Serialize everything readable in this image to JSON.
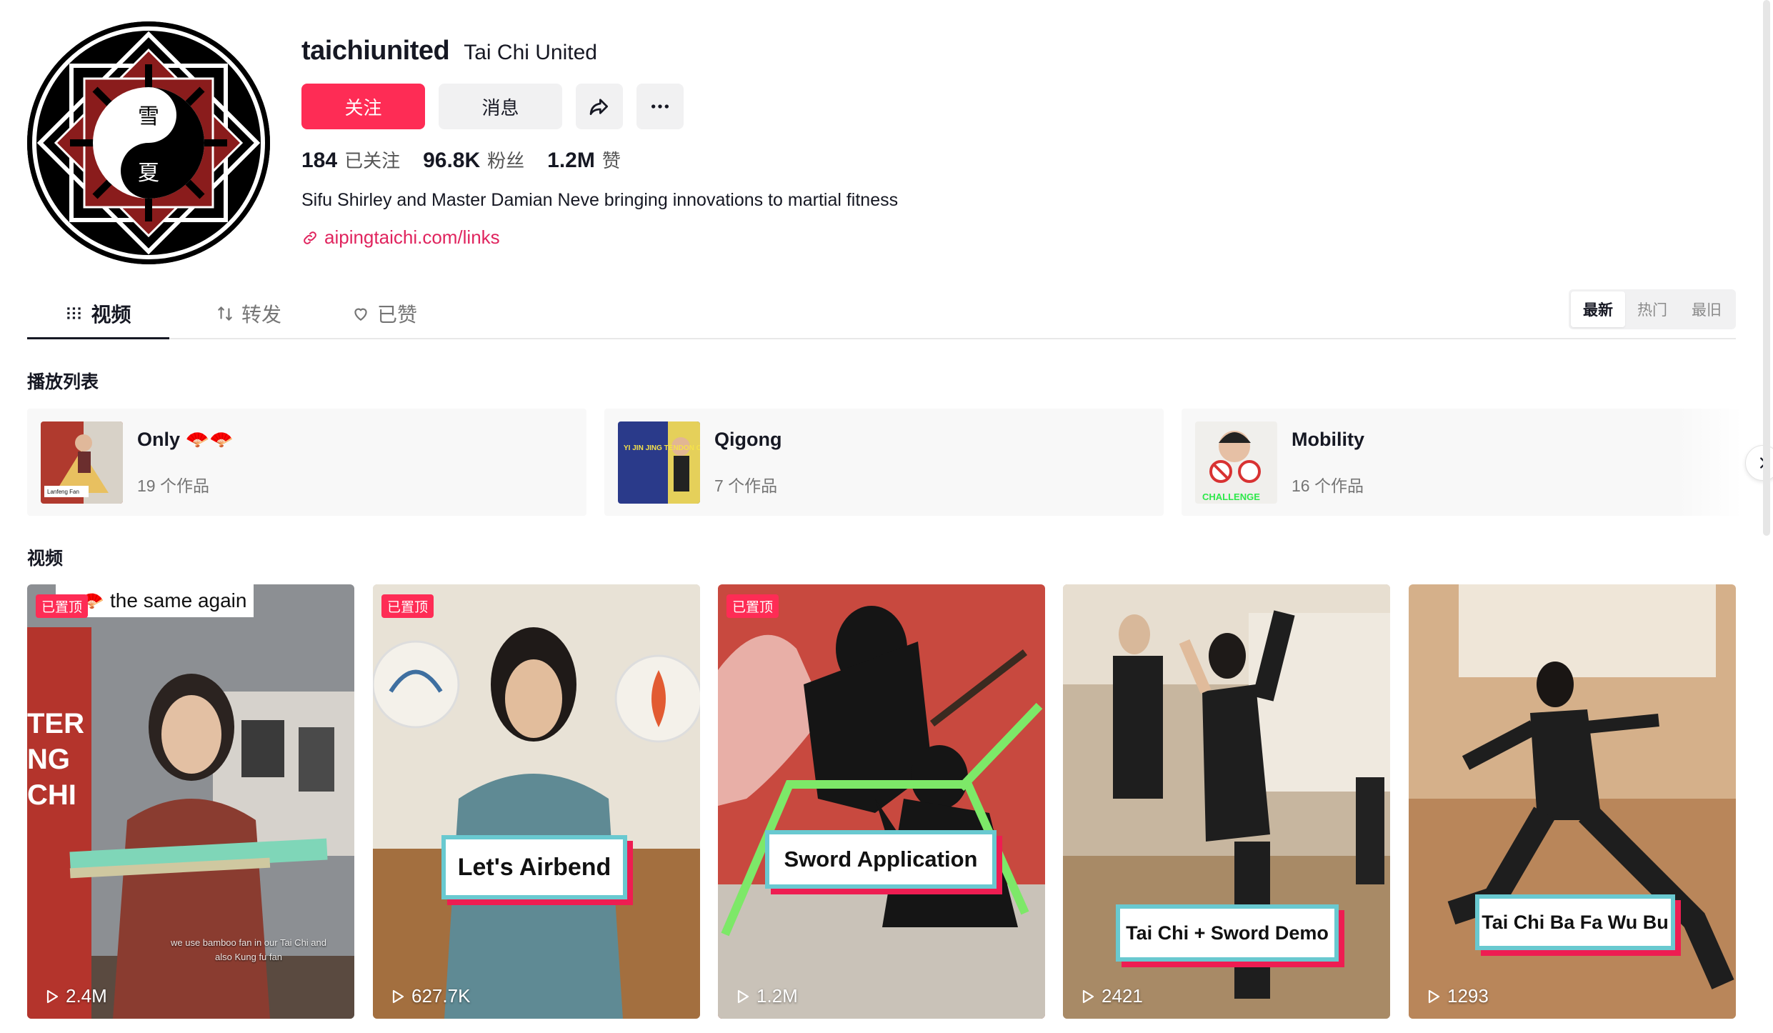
{
  "profile": {
    "username": "taichiunited",
    "nickname": "Tai Chi United",
    "avatar_glyph_top": "雪",
    "avatar_glyph_bottom": "夏",
    "follow_label": "关注",
    "message_label": "消息",
    "share_icon": "share-icon",
    "more_icon": "more-icon",
    "stats": [
      {
        "value": "184",
        "label": "已关注"
      },
      {
        "value": "96.8K",
        "label": "粉丝"
      },
      {
        "value": "1.2M",
        "label": "赞"
      }
    ],
    "bio": "Sifu Shirley and Master Damian Neve bringing innovations to martial fitness",
    "link": "aipingtaichi.com/links"
  },
  "tabs": [
    {
      "label": "视频",
      "icon": "grid-icon",
      "active": true
    },
    {
      "label": "转发",
      "icon": "repost-icon",
      "active": false
    },
    {
      "label": "已赞",
      "icon": "heart-icon",
      "active": false
    }
  ],
  "sort": [
    "最新",
    "热门",
    "最旧"
  ],
  "playlists_title": "播放列表",
  "playlists": [
    {
      "name": "Only 🪭🪭",
      "count": "19 个作品",
      "thumb_text": "Lanfeng Fan"
    },
    {
      "name": "Qigong",
      "count": "7 个作品",
      "thumb_text": "YI JIN JING TENDON CHANGING EXERCISES"
    },
    {
      "name": "Mobility",
      "count": "16 个作品",
      "thumb_text": "CHALLENGE"
    }
  ],
  "videos_title": "视频",
  "videos": [
    {
      "views": "2.4M",
      "pinned": "已置顶",
      "caption": "n 🪭 the same again",
      "sub": "we use bamboo fan in our Tai Chi and also Kung fu fan",
      "bg_text": "TER NG CHI"
    },
    {
      "views": "627.7K",
      "pinned": "已置顶",
      "caption": "Let's Airbend"
    },
    {
      "views": "1.2M",
      "pinned": "已置顶",
      "caption": "Sword Application"
    },
    {
      "views": "2421",
      "caption": "Tai Chi + Sword Demo"
    },
    {
      "views": "1293",
      "caption": "Tai Chi Ba Fa Wu Bu"
    }
  ],
  "colors": {
    "accent": "#fe2c55",
    "link": "#e0245e",
    "caption_border": "#69c9d0",
    "caption_shadow": "#ee1d52"
  }
}
